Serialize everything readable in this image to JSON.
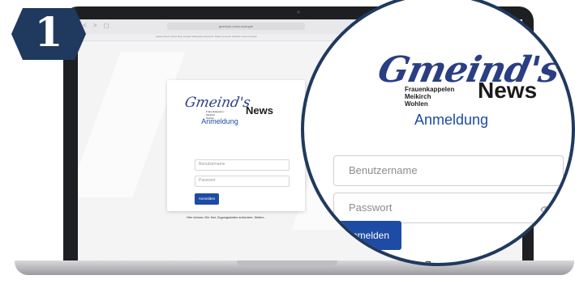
{
  "step": {
    "number": "1",
    "color": "#20395e"
  },
  "browser": {
    "url": "gmeinds-news.example",
    "bookmarks": "Apple  iCloud  Yahoo  Bing  Google  Wikipedia  Facebook  Twitter  LinkedIn  Weather  News  Popular",
    "nav_icons": "< > ◻"
  },
  "login": {
    "logo_script": "Gmeind's",
    "logo_news": "News",
    "logo_subtitle": [
      "Frauenkappelen",
      "Meikirch",
      "Wohlen"
    ],
    "title": "Anmeldung",
    "username_placeholder": "Benutzername",
    "password_placeholder": "Passwort",
    "submit_label": "Anmelden",
    "footer_text": "Hier können Sie Ihre Zugangsdaten anfordern: Weiter...",
    "footer_partial": "e Zugangsdaten",
    "accent_color": "#1e4ba3"
  },
  "icons": {
    "password_toggle": "eye-icon"
  }
}
